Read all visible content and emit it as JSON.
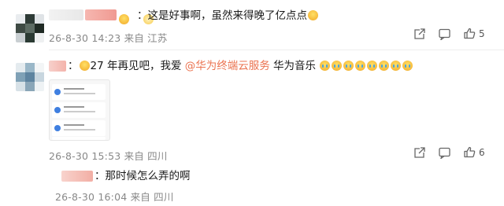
{
  "comments": [
    {
      "text": "：这是好事啊，虽然来得晚了亿点点",
      "time": "26-8-30 14:23",
      "location": "来自 江苏",
      "like_count": "5"
    },
    {
      "text_prefix": "：",
      "text_27": "27 年再见吧，我爱 ",
      "mention": "@华为终端云服务",
      "text_after": " 华为音乐",
      "time": "26-8-30 15:53",
      "location": "来自 四川",
      "like_count": "6"
    }
  ],
  "reply": {
    "text": "：那时候怎么弄的啊",
    "time": "26-8-30 16:04",
    "location": "来自 四川"
  },
  "icons": {
    "share": "share-icon",
    "comment": "comment-icon",
    "like": "thumbs-up-icon"
  },
  "colors": {
    "mention": "#eb7350",
    "meta": "#888888",
    "icon": "#666666"
  }
}
